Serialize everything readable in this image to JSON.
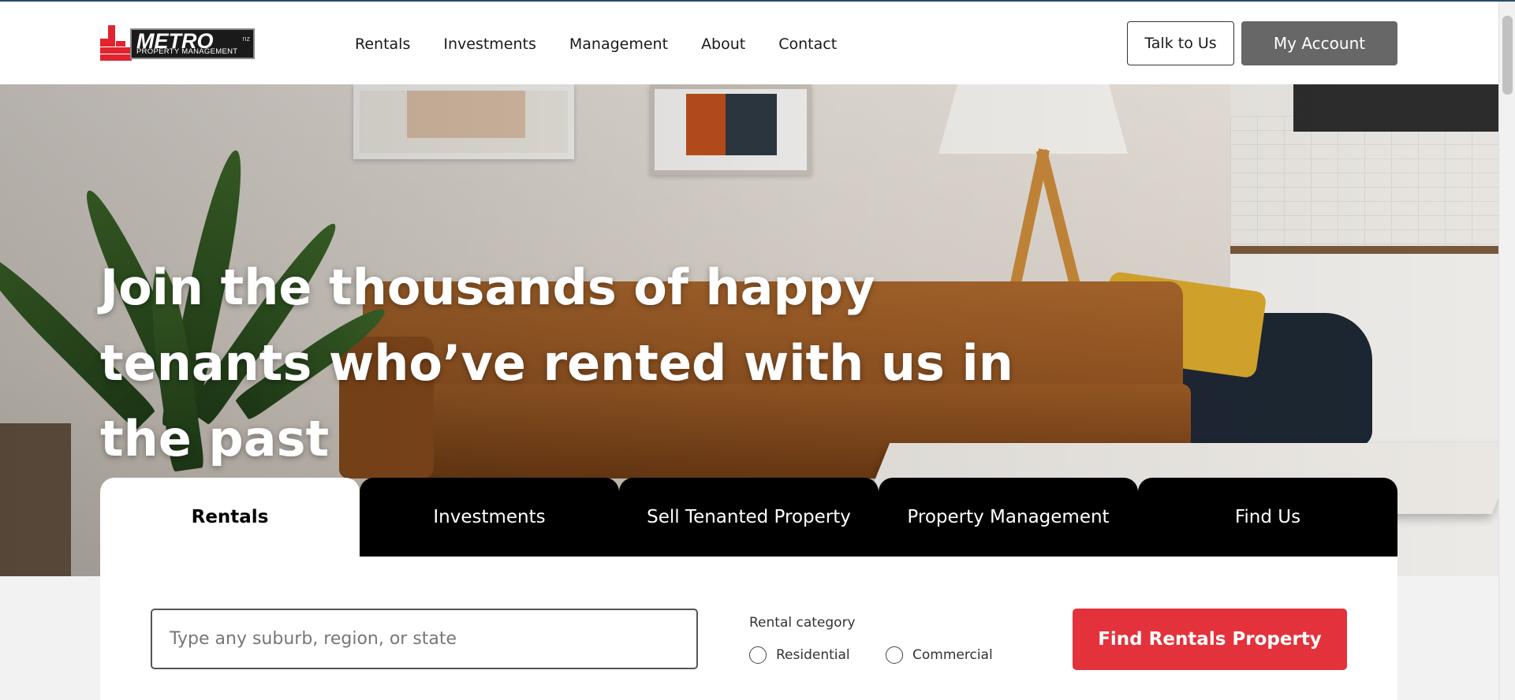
{
  "brand": {
    "logo_text": "METRO",
    "logo_suffix": "nz",
    "logo_subtitle": "PROPERTY MANAGEMENT"
  },
  "nav": {
    "items": [
      {
        "label": "Rentals"
      },
      {
        "label": "Investments"
      },
      {
        "label": "Management"
      },
      {
        "label": "About"
      },
      {
        "label": "Contact"
      }
    ]
  },
  "header_actions": {
    "talk_label": "Talk to Us",
    "account_label": "My Account"
  },
  "hero": {
    "headline": "Join the thousands of happy tenants who’ve rented with us in the past"
  },
  "tabs": [
    {
      "label": "Rentals",
      "active": true
    },
    {
      "label": "Investments",
      "active": false
    },
    {
      "label": "Sell Tenanted Property",
      "active": false
    },
    {
      "label": "Property Management",
      "active": false
    },
    {
      "label": "Find Us",
      "active": false
    }
  ],
  "search": {
    "placeholder": "Type any suburb, region, or state",
    "value": "",
    "category_label": "Rental category",
    "options": [
      {
        "label": "Residential",
        "checked": false
      },
      {
        "label": "Commercial",
        "checked": false
      }
    ],
    "submit_label": "Find Rentals Property"
  },
  "colors": {
    "accent": "#e3323b",
    "account_button": "#676767",
    "tab_bg": "#000000"
  }
}
